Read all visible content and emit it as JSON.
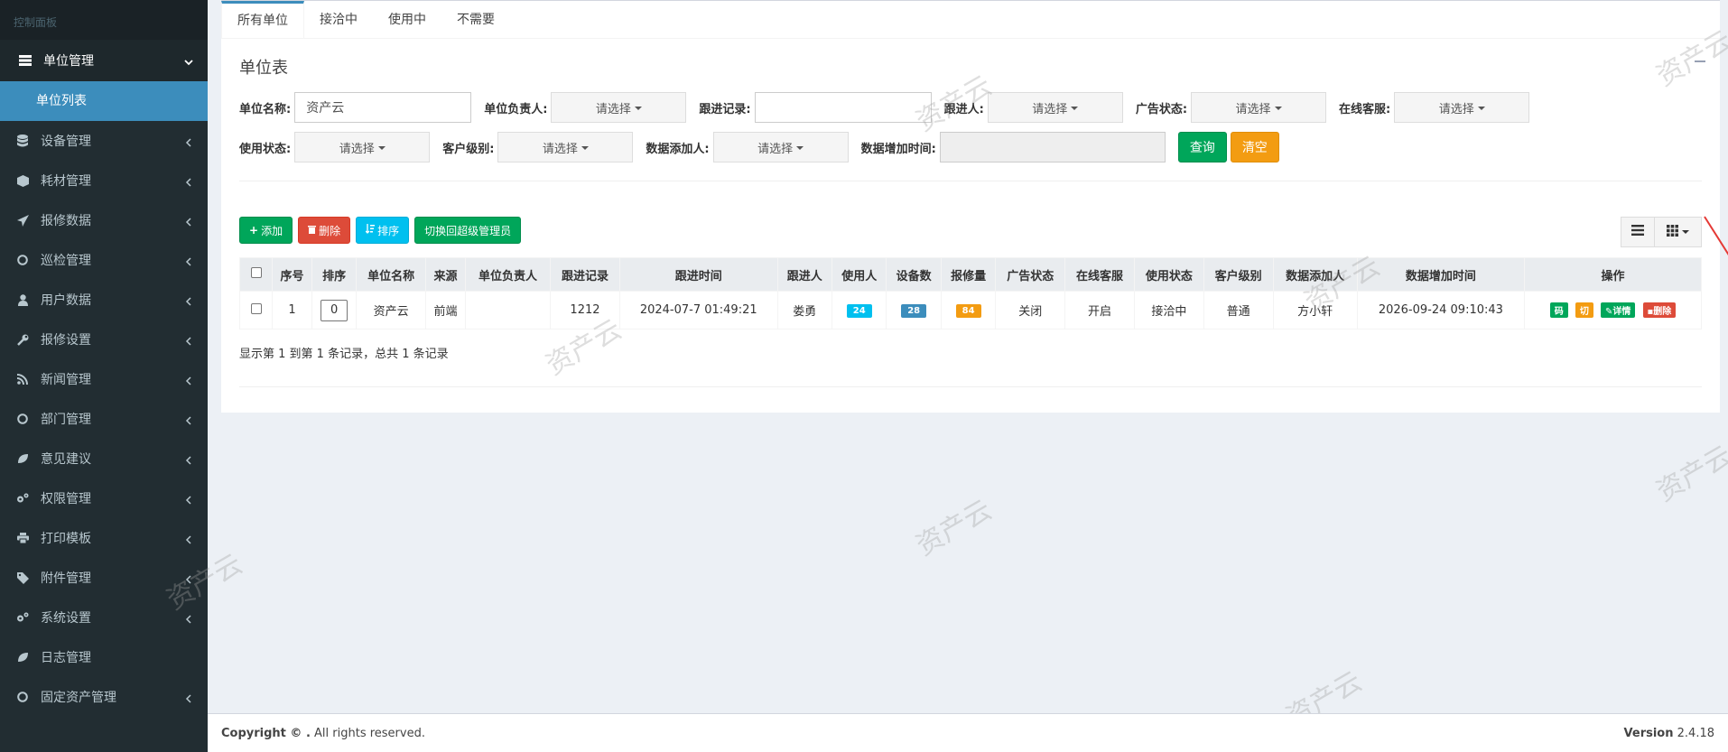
{
  "sidebar": {
    "header": "控制面板",
    "items": [
      {
        "label": "单位管理",
        "icon": "list-icon",
        "open": true
      },
      {
        "label": "设备管理",
        "icon": "database-icon"
      },
      {
        "label": "耗材管理",
        "icon": "cube-icon"
      },
      {
        "label": "报修数据",
        "icon": "paper-plane-icon"
      },
      {
        "label": "巡检管理",
        "icon": "circle-icon"
      },
      {
        "label": "用户数据",
        "icon": "user-icon"
      },
      {
        "label": "报修设置",
        "icon": "wrench-icon"
      },
      {
        "label": "新闻管理",
        "icon": "rss-icon"
      },
      {
        "label": "部门管理",
        "icon": "circle-icon"
      },
      {
        "label": "意见建议",
        "icon": "leaf-icon"
      },
      {
        "label": "权限管理",
        "icon": "cogs-icon"
      },
      {
        "label": "打印模板",
        "icon": "print-icon"
      },
      {
        "label": "附件管理",
        "icon": "tags-icon"
      },
      {
        "label": "系统设置",
        "icon": "cogs-icon"
      },
      {
        "label": "日志管理",
        "icon": "leaf-icon"
      },
      {
        "label": "固定资产管理",
        "icon": "circle-icon"
      }
    ],
    "submenu": [
      "单位列表"
    ]
  },
  "tabs": [
    "所有单位",
    "接洽中",
    "使用中",
    "不需要"
  ],
  "box_title": "单位表",
  "filters": {
    "unit_name_label": "单位名称:",
    "unit_name_value": "资产云",
    "unit_owner_label": "单位负责人:",
    "follow_record_label": "跟进记录:",
    "follower_label": "跟进人:",
    "ad_status_label": "广告状态:",
    "online_service_label": "在线客服:",
    "use_status_label": "使用状态:",
    "customer_level_label": "客户级别:",
    "data_adder_label": "数据添加人:",
    "data_add_time_label": "数据增加时间:",
    "select_placeholder": "请选择",
    "query_button": "查询",
    "clear_button": "清空"
  },
  "toolbar": {
    "add": "添加",
    "delete": "删除",
    "sort": "排序",
    "switch_admin": "切换回超级管理员"
  },
  "table": {
    "headers": [
      "序号",
      "排序",
      "单位名称",
      "来源",
      "单位负责人",
      "跟进记录",
      "跟进时间",
      "跟进人",
      "使用人",
      "设备数",
      "报修量",
      "广告状态",
      "在线客服",
      "使用状态",
      "客户级别",
      "数据添加人",
      "数据增加时间",
      "操作"
    ],
    "rows": [
      {
        "index": "1",
        "sort": "0",
        "unit_name": "资产云",
        "source": "前端",
        "owner": "",
        "follow_record": "1212",
        "follow_time": "2024-07-7 01:49:21",
        "follower": "娄勇",
        "users": "24",
        "devices": "28",
        "repairs": "84",
        "ad_status": "关闭",
        "online_service": "开启",
        "use_status": "接洽中",
        "customer_level": "普通",
        "data_adder": "方小轩",
        "data_add_time": "2026-09-24 09:10:43",
        "ops": {
          "code": "码",
          "cut": "切",
          "detail": "详情",
          "delete": "删除"
        }
      }
    ]
  },
  "summary": "显示第 1 到第 1 条记录，总共 1 条记录",
  "footer": {
    "copyright_bold": "Copyright © .",
    "copyright_rest": " All rights reserved.",
    "version_label": "Version",
    "version_value": "2.4.18"
  },
  "watermark_text": "资产云",
  "colors": {
    "sidebar_bg": "#222d32",
    "active_blue": "#3c8dbc",
    "success": "#00a65a",
    "warning": "#f39c12",
    "danger": "#dd4b39",
    "info": "#00c0ef",
    "arrow_red": "#e53935"
  }
}
